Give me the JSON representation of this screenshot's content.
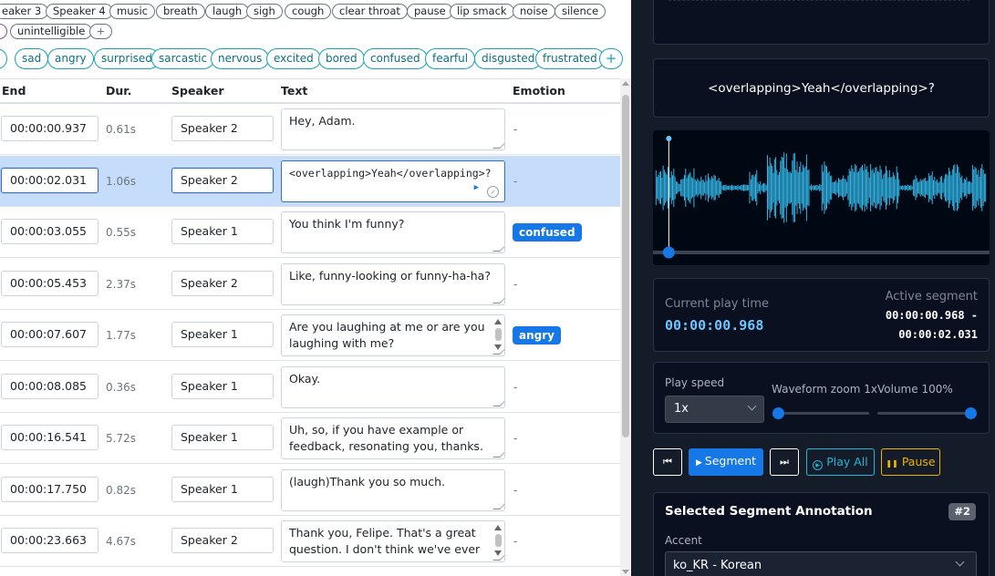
{
  "speaker_tags": [
    "eaker 3",
    "Speaker 4",
    "music",
    "breath",
    "laugh",
    "sigh",
    "cough",
    "clear throat",
    "pause",
    "lip smack",
    "noise",
    "silence"
  ],
  "speaker_tags_row2": [
    "unintelligible"
  ],
  "emotion_tags": [
    "sad",
    "angry",
    "surprised",
    "sarcastic",
    "nervous",
    "excited",
    "bored",
    "confused",
    "fearful",
    "disgusted",
    "frustrated"
  ],
  "add_label": "+",
  "table": {
    "headers": {
      "end": "End",
      "dur": "Dur.",
      "speaker": "Speaker",
      "text": "Text",
      "emotion": "Emotion"
    },
    "rows": [
      {
        "end": "00:00:00.937",
        "dur": "0.61s",
        "speaker": "Speaker 2",
        "text": "Hey, Adam.",
        "emotion": "-"
      },
      {
        "end": "00:00:02.031",
        "dur": "1.06s",
        "speaker": "Speaker 2",
        "text": "<overlapping>Yeah</overlapping>?",
        "emotion": "-"
      },
      {
        "end": "00:00:03.055",
        "dur": "0.55s",
        "speaker": "Speaker 1",
        "text": "You think I'm funny?",
        "emotion": "confused"
      },
      {
        "end": "00:00:05.453",
        "dur": "2.37s",
        "speaker": "Speaker 2",
        "text": "Like, funny-looking or funny-ha-ha?",
        "emotion": "-"
      },
      {
        "end": "00:00:07.607",
        "dur": "1.77s",
        "speaker": "Speaker 1",
        "text": "Are you laughing at me or are you laughing with me?",
        "emotion": "angry"
      },
      {
        "end": "00:00:08.085",
        "dur": "0.36s",
        "speaker": "Speaker 1",
        "text": "Okay.",
        "emotion": "-"
      },
      {
        "end": "00:00:16.541",
        "dur": "5.72s",
        "speaker": "Speaker 1",
        "text": "Uh, so, if you have example or feedback, resonating you, thanks.",
        "emotion": "-"
      },
      {
        "end": "00:00:17.750",
        "dur": "0.82s",
        "speaker": "Speaker 1",
        "text": "(laugh)Thank you so much.",
        "emotion": "-"
      },
      {
        "end": "00:00:23.663",
        "dur": "4.67s",
        "speaker": "Speaker 2",
        "text": "Thank you, Felipe. That's a great question. I don't think we've ever",
        "emotion": "-"
      }
    ]
  },
  "right": {
    "current_text": "<overlapping>Yeah</overlapping>?",
    "current_play_time_label": "Current play time",
    "current_play_time": "00:00:00.968",
    "active_segment_label": "Active segment",
    "active_segment_start": "00:00:00.968 -",
    "active_segment_end": "00:00:02.031",
    "play_speed_label": "Play speed",
    "play_speed_value": "1x",
    "waveform_zoom_label": "Waveform zoom 1x",
    "volume_label": "Volume 100%",
    "zoom_level": 0.0,
    "volume_level": 1.0,
    "playhead_fraction": 0.047,
    "buttons": {
      "prev": "⏮",
      "segment": "Segment",
      "next": "⏭",
      "play_all": "Play All",
      "pause": "Pause"
    },
    "annotation_title": "Selected Segment Annotation",
    "annotation_badge": "#2",
    "accent_label": "Accent",
    "accent_value": "ko_KR - Korean"
  },
  "colors": {
    "accent": "#1677e6",
    "wave": "#33b5e5",
    "badge": "#1677e6",
    "dark_bg": "#141c29"
  }
}
